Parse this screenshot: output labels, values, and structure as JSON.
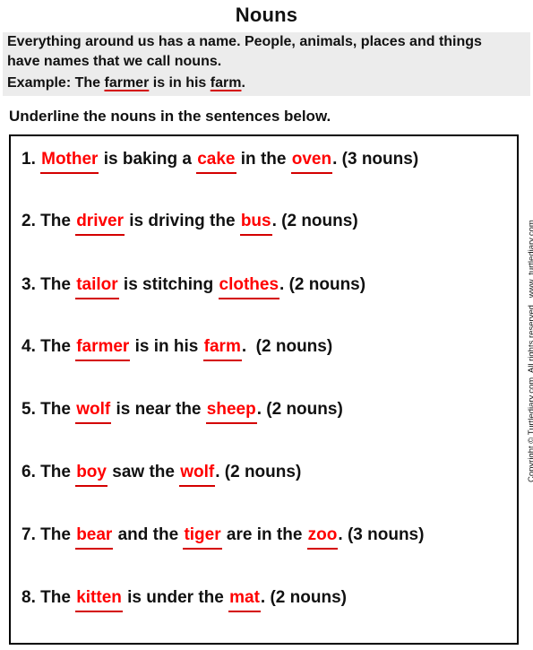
{
  "page": {
    "title": "Nouns",
    "intro": {
      "line1": "Everything around us has a name. People, animals, places and things",
      "line2": "have names that we call nouns.",
      "example": {
        "prefix": "Example: The ",
        "noun1": "farmer",
        "middle": " is in his ",
        "noun2": "farm",
        "suffix": "."
      }
    },
    "instruction": "Underline the nouns in the sentences below.",
    "copyright": "Copyright © Turtlediary.com. All rights reserved   www. turtlediary.com",
    "colors": {
      "noun_text": "#ff0000",
      "underline": "#d40000",
      "intro_background": "#ececec"
    }
  },
  "sentences": [
    {
      "parts": [
        {
          "t": "1. ",
          "noun": false
        },
        {
          "t": "Mother",
          "noun": true
        },
        {
          "t": " is baking a ",
          "noun": false
        },
        {
          "t": "cake",
          "noun": true
        },
        {
          "t": " in the ",
          "noun": false
        },
        {
          "t": "oven",
          "noun": true
        },
        {
          "t": ". (3 nouns)",
          "noun": false
        }
      ]
    },
    {
      "parts": [
        {
          "t": "2. The ",
          "noun": false
        },
        {
          "t": "driver",
          "noun": true
        },
        {
          "t": " is driving the ",
          "noun": false
        },
        {
          "t": "bus",
          "noun": true
        },
        {
          "t": ". (2 nouns)",
          "noun": false
        }
      ]
    },
    {
      "parts": [
        {
          "t": "3. The ",
          "noun": false
        },
        {
          "t": "tailor",
          "noun": true
        },
        {
          "t": " is stitching ",
          "noun": false
        },
        {
          "t": "clothes",
          "noun": true
        },
        {
          "t": ". (2 nouns)",
          "noun": false
        }
      ]
    },
    {
      "parts": [
        {
          "t": "4. The ",
          "noun": false
        },
        {
          "t": "farmer",
          "noun": true
        },
        {
          "t": " is in his ",
          "noun": false
        },
        {
          "t": "farm",
          "noun": true
        },
        {
          "t": ".  (2 nouns)",
          "noun": false
        }
      ]
    },
    {
      "parts": [
        {
          "t": "5. The ",
          "noun": false
        },
        {
          "t": "wolf",
          "noun": true
        },
        {
          "t": " is near the ",
          "noun": false
        },
        {
          "t": "sheep",
          "noun": true
        },
        {
          "t": ". (2 nouns)",
          "noun": false
        }
      ]
    },
    {
      "parts": [
        {
          "t": "6. The ",
          "noun": false
        },
        {
          "t": "boy",
          "noun": true
        },
        {
          "t": " saw the ",
          "noun": false
        },
        {
          "t": "wolf",
          "noun": true
        },
        {
          "t": ". (2 nouns)",
          "noun": false
        }
      ]
    },
    {
      "parts": [
        {
          "t": "7. The ",
          "noun": false
        },
        {
          "t": "bear",
          "noun": true
        },
        {
          "t": " and the ",
          "noun": false
        },
        {
          "t": "tiger",
          "noun": true
        },
        {
          "t": " are in the ",
          "noun": false
        },
        {
          "t": "zoo",
          "noun": true
        },
        {
          "t": ". (3 nouns)",
          "noun": false
        }
      ]
    },
    {
      "parts": [
        {
          "t": "8. The ",
          "noun": false
        },
        {
          "t": "kitten",
          "noun": true
        },
        {
          "t": " is under the ",
          "noun": false
        },
        {
          "t": "mat",
          "noun": true
        },
        {
          "t": ". (2 nouns)",
          "noun": false
        }
      ]
    }
  ]
}
